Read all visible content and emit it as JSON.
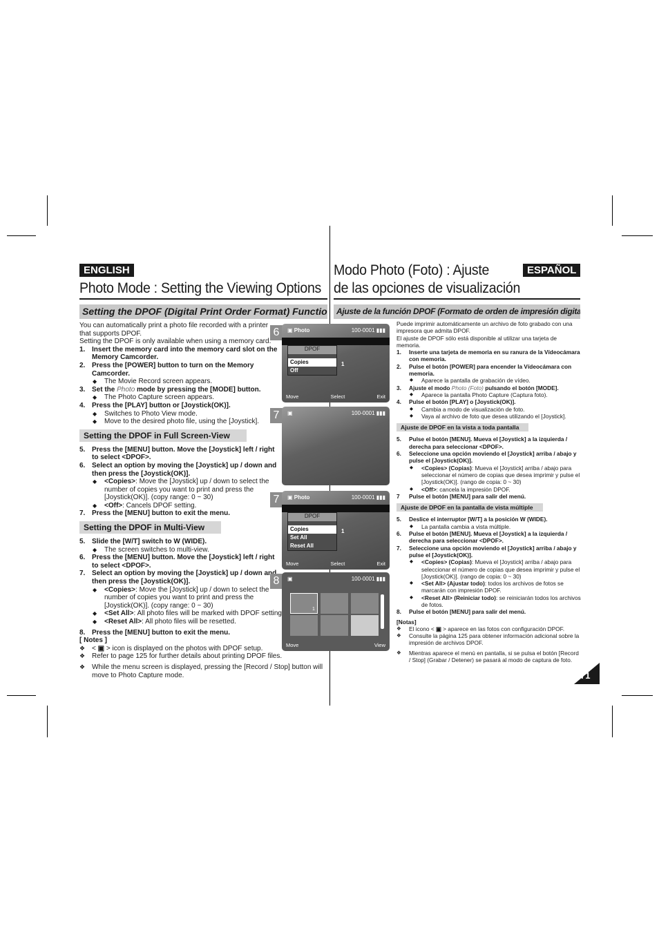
{
  "header": {
    "en_badge": "ENGLISH",
    "en_title": "Photo Mode : Setting the Viewing Options",
    "es_badge": "ESPAÑOL",
    "es_title_1": "Modo Photo (Foto) : Ajuste",
    "es_title_2": "de las opciones de visualización",
    "en_subtitle": "Setting the DPOF (Digital Print Order Format) Function",
    "es_subtitle": "Ajuste de la función DPOF (Formato de orden de impresión digital)"
  },
  "en": {
    "blocks": [
      {
        "k": "p",
        "segs": [
          [
            "r",
            "You can automatically print a photo file recorded with a printer that supports DPOF."
          ]
        ]
      },
      {
        "k": "p",
        "segs": [
          [
            "r",
            "Setting the DPOF is only available when using a memory card."
          ]
        ]
      },
      {
        "k": "step",
        "n": "1.",
        "segs": [
          [
            "b",
            "Insert the memory card into the memory card slot on the Memory Camcorder."
          ]
        ]
      },
      {
        "k": "step",
        "n": "2.",
        "segs": [
          [
            "b",
            "Press the [POWER] button to turn on the Memory Camcorder."
          ]
        ]
      },
      {
        "k": "bul",
        "segs": [
          [
            "r",
            "The Movie Record screen appears."
          ]
        ]
      },
      {
        "k": "step",
        "n": "3.",
        "segs": [
          [
            "b",
            "Set the "
          ],
          [
            "i",
            "Photo"
          ],
          [
            "b",
            " mode by pressing the [MODE] button."
          ]
        ]
      },
      {
        "k": "bul",
        "segs": [
          [
            "r",
            "The Photo Capture screen appears."
          ]
        ]
      },
      {
        "k": "step",
        "n": "4.",
        "segs": [
          [
            "b",
            "Press the [PLAY] button or [Joystick(OK)]."
          ]
        ]
      },
      {
        "k": "bul",
        "segs": [
          [
            "r",
            "Switches to Photo View mode."
          ]
        ]
      },
      {
        "k": "bul",
        "segs": [
          [
            "r",
            "Move to the desired photo file, using the [Joystick]."
          ]
        ]
      },
      {
        "k": "sec",
        "segs": [
          [
            "b",
            "Setting the DPOF in Full Screen-View"
          ]
        ]
      },
      {
        "k": "step",
        "n": "5.",
        "segs": [
          [
            "b",
            "Press the [MENU] button. Move the [Joystick] left / right to select <DPOF>."
          ]
        ]
      },
      {
        "k": "step",
        "n": "6.",
        "segs": [
          [
            "b",
            "Select an option by moving the [Joystick] up / down and then press the [Joystick(OK)]."
          ]
        ]
      },
      {
        "k": "bul",
        "segs": [
          [
            "b",
            "<Copies>"
          ],
          [
            "r",
            ": Move the [Joystick] up / down to select the number of copies you want to print and press the [Joystick(OK)]. (copy range: 0 ~ 30)"
          ]
        ]
      },
      {
        "k": "bul",
        "segs": [
          [
            "b",
            "<Off>"
          ],
          [
            "r",
            ": Cancels DPOF setting."
          ]
        ]
      },
      {
        "k": "step",
        "n": "7.",
        "segs": [
          [
            "b",
            "Press the [MENU] button to exit the menu."
          ]
        ]
      },
      {
        "k": "sec",
        "segs": [
          [
            "b",
            "Setting the DPOF in Multi-View"
          ]
        ]
      },
      {
        "k": "step",
        "n": "5.",
        "segs": [
          [
            "b",
            "Slide the [W/T] switch to W (WIDE)."
          ]
        ]
      },
      {
        "k": "bul",
        "segs": [
          [
            "r",
            "The screen switches to multi-view."
          ]
        ]
      },
      {
        "k": "step",
        "n": "6.",
        "segs": [
          [
            "b",
            "Press the [MENU] button. Move the [Joystick] left / right to select <DPOF>."
          ]
        ]
      },
      {
        "k": "step",
        "n": "7.",
        "segs": [
          [
            "b",
            "Select an option by moving the [Joystick] up / down and then press the [Joystick(OK)]."
          ]
        ]
      },
      {
        "k": "bul",
        "segs": [
          [
            "b",
            "<Copies>"
          ],
          [
            "r",
            ": Move the  [Joystick] up / down to select the number of copies you want to print and press the [Joystick(OK)]. (copy range: 0 ~ 30)"
          ]
        ]
      },
      {
        "k": "bul wide",
        "segs": [
          [
            "b",
            "<Set All>"
          ],
          [
            "r",
            ": All photo files will be marked with DPOF settings."
          ]
        ]
      },
      {
        "k": "bul",
        "segs": [
          [
            "b",
            "<Reset All>"
          ],
          [
            "r",
            ": All photo files will be resetted."
          ]
        ]
      },
      {
        "k": "step gap",
        "n": "8.",
        "segs": [
          [
            "b",
            "Press the [MENU] button to exit the menu."
          ]
        ]
      },
      {
        "k": "p",
        "segs": [
          [
            "b",
            "[ Notes ]"
          ]
        ]
      },
      {
        "k": "note wide",
        "segs": [
          [
            "r",
            "< "
          ],
          [
            "b",
            "▣"
          ],
          [
            "r",
            " > icon is displayed on the photos with DPOF setup."
          ]
        ]
      },
      {
        "k": "note wide",
        "segs": [
          [
            "r",
            "Refer to page 125 for further details about printing DPOF files."
          ]
        ]
      },
      {
        "k": "note wide gap",
        "segs": [
          [
            "r",
            "While the menu screen is displayed, pressing the [Record / Stop] button will move to Photo Capture mode."
          ]
        ]
      }
    ]
  },
  "es": {
    "blocks": [
      {
        "k": "p",
        "segs": [
          [
            "r",
            "Puede imprimir automáticamente un archivo de foto grabado con una impresora que admita DPOF."
          ]
        ]
      },
      {
        "k": "p",
        "segs": [
          [
            "r",
            "El ajuste de DPOF sólo está disponible al utilizar una tarjeta de memoria."
          ]
        ]
      },
      {
        "k": "step",
        "n": "1.",
        "segs": [
          [
            "b",
            "Inserte una tarjeta de memoria en su ranura de la Vídeocámara con memoria."
          ]
        ]
      },
      {
        "k": "step",
        "n": "2.",
        "segs": [
          [
            "b",
            "Pulse el botón [POWER] para encender la Vídeocámara con memoria."
          ]
        ]
      },
      {
        "k": "bul",
        "segs": [
          [
            "r",
            "Aparece la pantalla de grabación de vídeo."
          ]
        ]
      },
      {
        "k": "step",
        "n": "3.",
        "segs": [
          [
            "b",
            "Ajuste el modo "
          ],
          [
            "i",
            "Photo (Foto)"
          ],
          [
            "b",
            " pulsando el botón [MODE]."
          ]
        ]
      },
      {
        "k": "bul",
        "segs": [
          [
            "r",
            "Aparece la pantalla Photo Capture (Captura foto)."
          ]
        ]
      },
      {
        "k": "step",
        "n": "4.",
        "segs": [
          [
            "b",
            "Pulse el botón [PLAY] o [Joystick(OK)]."
          ]
        ]
      },
      {
        "k": "bul",
        "segs": [
          [
            "r",
            "Cambia a modo de visualización de foto."
          ]
        ]
      },
      {
        "k": "bul",
        "segs": [
          [
            "r",
            "Vaya al archivo de foto que desea utilizando el [Joystick]."
          ]
        ]
      },
      {
        "k": "sec",
        "segs": [
          [
            "b",
            "Ajuste de DPOF en la vista a toda pantalla"
          ]
        ]
      },
      {
        "k": "step",
        "n": "5.",
        "segs": [
          [
            "b",
            "Pulse el botón [MENU]. Mueva el [Joystick] a la izquierda / derecha para seleccionar <DPOF>."
          ]
        ]
      },
      {
        "k": "step",
        "n": "6.",
        "segs": [
          [
            "b",
            "Seleccione una opción moviendo el [Joystick] arriba / abajo y pulse el [Joystick(OK)]."
          ]
        ]
      },
      {
        "k": "bul",
        "segs": [
          [
            "b",
            "<Copies> (Copias)"
          ],
          [
            "r",
            ": Mueva el [Joystick] arriba / abajo para seleccionar el número de copias que desea imprimir y pulse el [Joystick(OK)]. (rango de copia: 0 ~ 30)"
          ]
        ]
      },
      {
        "k": "bul",
        "segs": [
          [
            "b",
            "<Off>"
          ],
          [
            "r",
            ": cancela la impresión DPOF."
          ]
        ]
      },
      {
        "k": "step",
        "n": "7",
        "segs": [
          [
            "b",
            "Pulse el botón [MENU] para salir del menú."
          ]
        ]
      },
      {
        "k": "sec",
        "segs": [
          [
            "b",
            "Ajuste de DPOF en la pantalla de vista múltiple"
          ]
        ]
      },
      {
        "k": "step",
        "n": "5.",
        "segs": [
          [
            "b",
            "Deslice el interruptor [W/T] a la posición W (WIDE)."
          ]
        ]
      },
      {
        "k": "bul",
        "segs": [
          [
            "r",
            "La pantalla cambia a vista múltiple."
          ]
        ]
      },
      {
        "k": "step",
        "n": "6.",
        "segs": [
          [
            "b",
            "Pulse el botón [MENU]. Mueva el [Joystick] a la izquierda / derecha para seleccionar <DPOF>."
          ]
        ]
      },
      {
        "k": "step",
        "n": "7.",
        "segs": [
          [
            "b",
            "Seleccione una opción moviendo el [Joystick] arriba / abajo y pulse el [Joystick(OK)]."
          ]
        ]
      },
      {
        "k": "bul",
        "segs": [
          [
            "b",
            "<Copies> (Copias)"
          ],
          [
            "r",
            ": Mueva el [Joystick] arriba / abajo para seleccionar el número de copias que desea imprimir y pulse el [Joystick(OK)]. (rango de copia: 0 ~ 30)"
          ]
        ]
      },
      {
        "k": "bul",
        "segs": [
          [
            "b",
            "<Set All> (Ajustar todo)"
          ],
          [
            "r",
            ": todos los archivos de fotos se marcarán con impresión DPOF."
          ]
        ]
      },
      {
        "k": "bul",
        "segs": [
          [
            "b",
            "<Reset All> (Reiniciar todo)"
          ],
          [
            "r",
            ": se reiniciarán todos los archivos de fotos."
          ]
        ]
      },
      {
        "k": "step",
        "n": "8.",
        "segs": [
          [
            "b",
            "Pulse el botón [MENU] para salir del menú."
          ]
        ]
      },
      {
        "k": "p gap",
        "segs": [
          [
            "b",
            "[Notas]"
          ]
        ]
      },
      {
        "k": "note",
        "segs": [
          [
            "r",
            "El icono < "
          ],
          [
            "b",
            "▣"
          ],
          [
            "r",
            " > aparece en las fotos con configuración DPOF."
          ]
        ]
      },
      {
        "k": "note",
        "segs": [
          [
            "r",
            "Consulte la página 125 para obtener información adicional sobre la impresión de archivos DPOF."
          ]
        ]
      },
      {
        "k": "note gap",
        "segs": [
          [
            "r",
            "Mientras aparece el menú en pantalla, si se pulsa el botón [Record / Stop] (Grabar / Detener) se pasará al modo de captura de foto."
          ]
        ]
      }
    ]
  },
  "screens": [
    {
      "step": "6",
      "mode": "Photo",
      "file": "100-0001",
      "menu_title": "DPOF",
      "options": [
        "Copies",
        "Off"
      ],
      "value": "1",
      "footer": [
        "Move",
        "Select",
        "Exit"
      ]
    },
    {
      "step": "7",
      "mode": "",
      "file": "100-0001",
      "footer": []
    },
    {
      "step": "7",
      "mode": "Photo",
      "file": "100-0001",
      "menu_title": "DPOF",
      "options": [
        "Copies",
        "Set All",
        "Reset All"
      ],
      "value": "1",
      "footer": [
        "Move",
        "Select",
        "Exit"
      ]
    },
    {
      "step": "8",
      "mode": "",
      "file": "100-0001",
      "thumb_badge": "1",
      "footer": [
        "Move",
        "View"
      ]
    }
  ],
  "page_number": "71"
}
